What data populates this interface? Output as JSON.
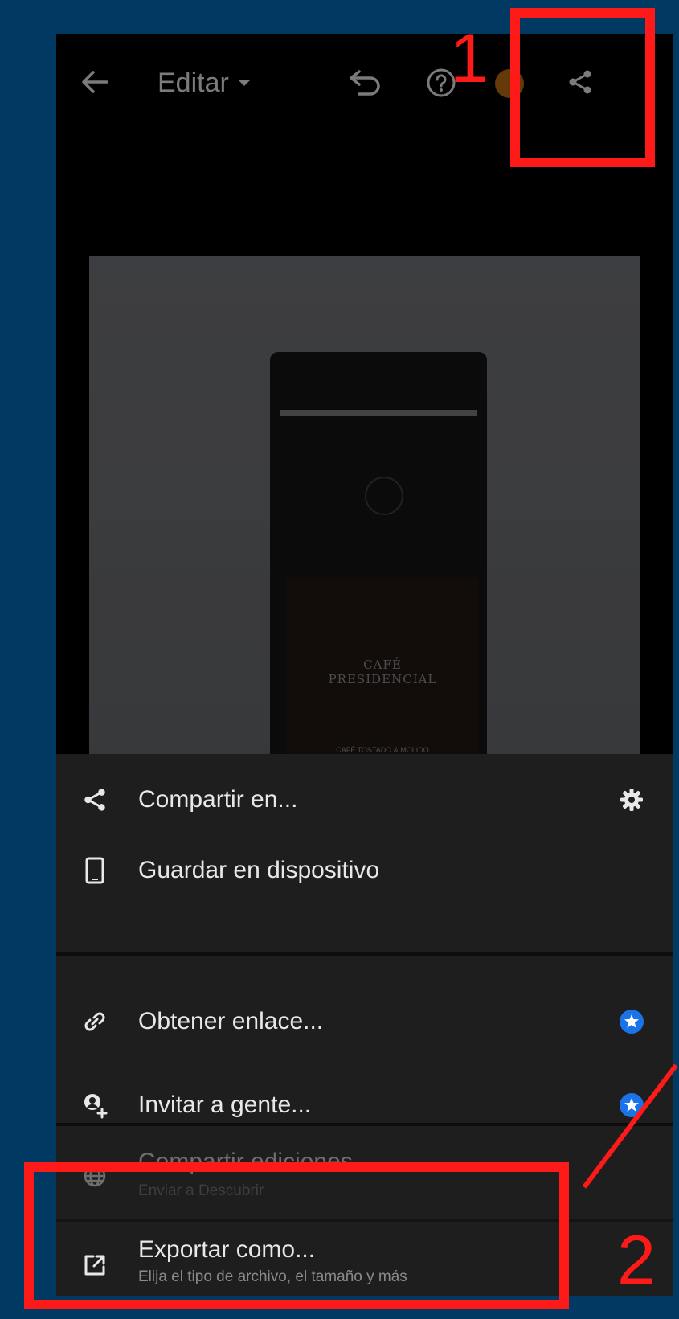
{
  "header": {
    "title": "Editar",
    "icons": {
      "back": "arrow-left-icon",
      "undo": "undo-icon",
      "help": "help-circle-icon",
      "share": "share-icon"
    }
  },
  "photo": {
    "brand_line1": "CAFÉ",
    "brand_line2": "PRESIDENCIAL",
    "brand_small": "CAFÉ TOSTADO & MOLIDO"
  },
  "menu": {
    "share_to": "Compartir en...",
    "save_device": "Guardar en dispositivo",
    "get_link": "Obtener enlace...",
    "invite": "Invitar a gente...",
    "share_edits": "Compartir ediciones",
    "share_edits_sub": "Enviar a Descubrir",
    "export_as": "Exportar como...",
    "export_as_sub": "Elija el tipo de archivo, el tamaño y más"
  },
  "annotations": {
    "one": "1",
    "two": "2"
  },
  "colors": {
    "annotation": "#ff1a1a",
    "premium_badge": "#1a73e8",
    "background": "#003a63"
  }
}
